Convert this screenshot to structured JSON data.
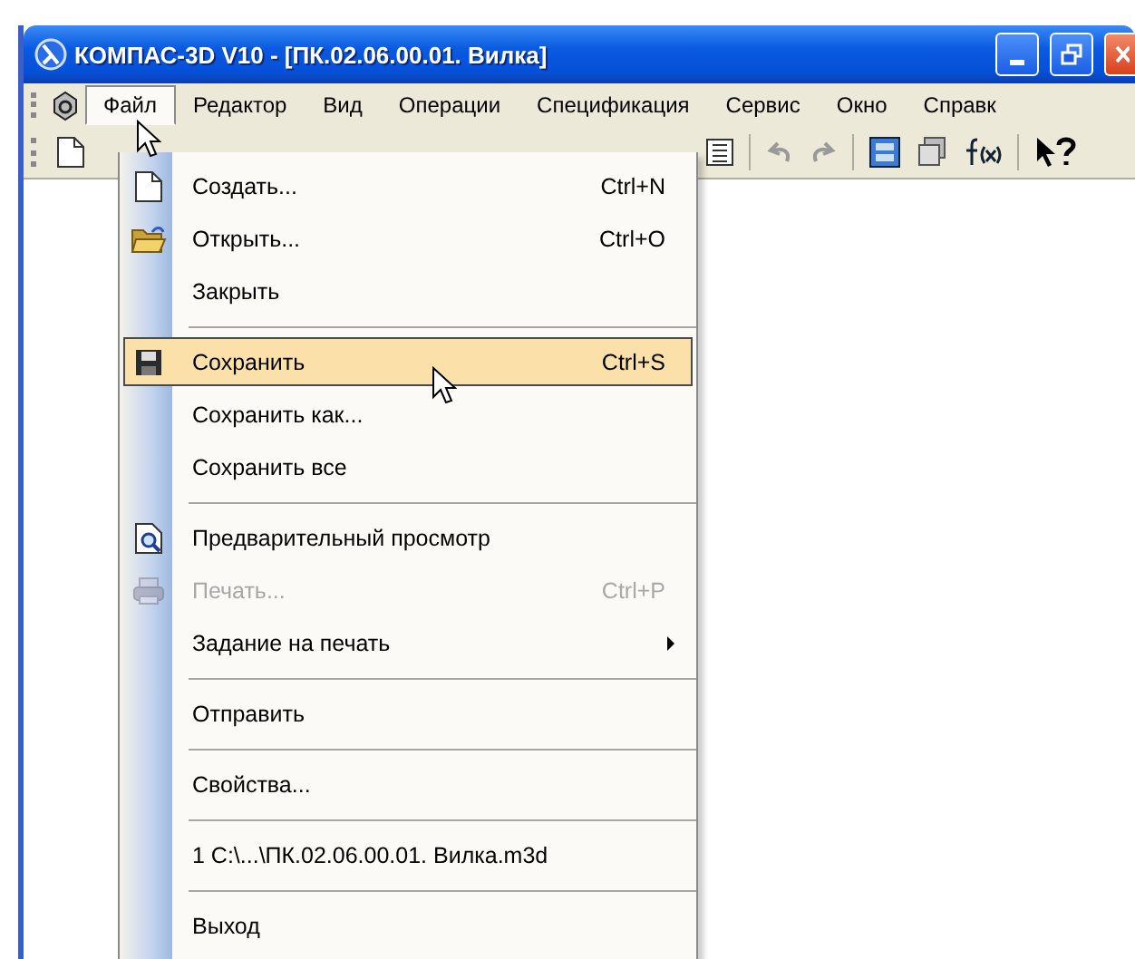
{
  "window": {
    "title": "КОМПАС-3D V10 - [ПК.02.06.00.01. Вилка]"
  },
  "menu_bar": [
    {
      "label": "Файл",
      "selected": true
    },
    {
      "label": "Редактор",
      "selected": false
    },
    {
      "label": "Вид",
      "selected": false
    },
    {
      "label": "Операции",
      "selected": false
    },
    {
      "label": "Спецификация",
      "selected": false
    },
    {
      "label": "Сервис",
      "selected": false
    },
    {
      "label": "Окно",
      "selected": false
    },
    {
      "label": "Справк",
      "selected": false
    }
  ],
  "file_menu": [
    {
      "kind": "item",
      "label": "Создать...",
      "shortcut": "Ctrl+N",
      "selected": false,
      "disabled": false
    },
    {
      "kind": "item",
      "label": "Открыть...",
      "shortcut": "Ctrl+O",
      "selected": false,
      "disabled": false
    },
    {
      "kind": "item",
      "label": "Закрыть",
      "selected": false,
      "disabled": false
    },
    {
      "kind": "separator"
    },
    {
      "kind": "item",
      "label": "Сохранить",
      "shortcut": "Ctrl+S",
      "selected": true,
      "disabled": false
    },
    {
      "kind": "item",
      "label": "Сохранить как...",
      "selected": false,
      "disabled": false
    },
    {
      "kind": "item",
      "label": "Сохранить все",
      "selected": false,
      "disabled": false
    },
    {
      "kind": "separator"
    },
    {
      "kind": "item",
      "label": "Предварительный просмотр",
      "selected": false,
      "disabled": false
    },
    {
      "kind": "item",
      "label": "Печать...",
      "shortcut": "Ctrl+P",
      "selected": false,
      "disabled": true
    },
    {
      "kind": "submenu",
      "label": "Задание на печать",
      "selected": false,
      "disabled": false
    },
    {
      "kind": "separator"
    },
    {
      "kind": "item",
      "label": "Отправить",
      "selected": false,
      "disabled": false
    },
    {
      "kind": "separator"
    },
    {
      "kind": "item",
      "label": "Свойства...",
      "selected": false,
      "disabled": false
    },
    {
      "kind": "separator"
    },
    {
      "kind": "item",
      "label": "1 C:\\...\\ПК.02.06.00.01. Вилка.m3d",
      "selected": false,
      "disabled": false
    },
    {
      "kind": "separator"
    },
    {
      "kind": "item",
      "label": "Выход",
      "selected": false,
      "disabled": false
    }
  ]
}
